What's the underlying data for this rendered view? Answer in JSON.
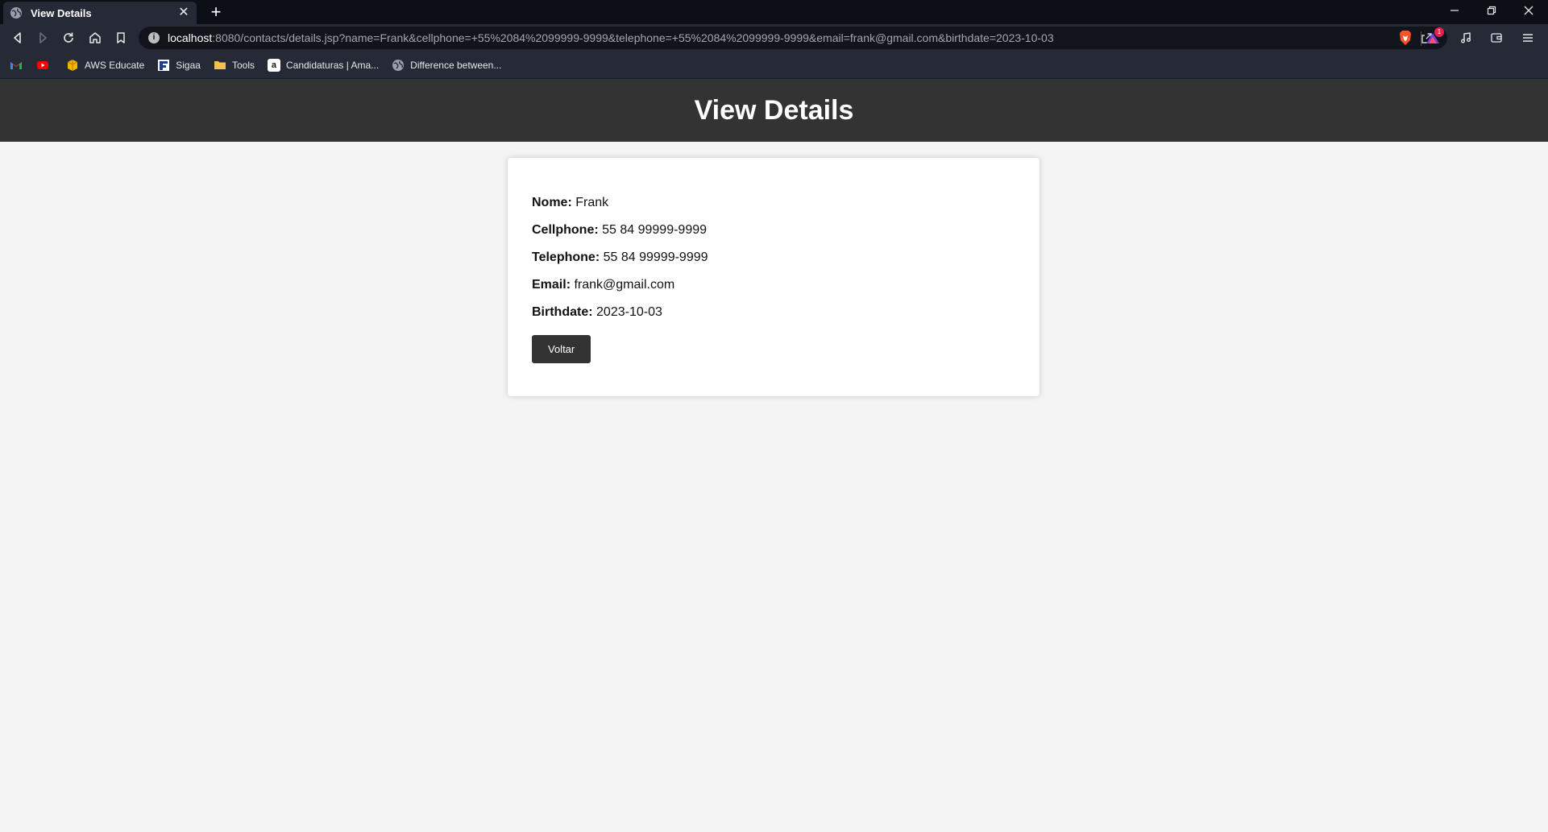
{
  "browser": {
    "tab_title": "View Details",
    "url_host": "localhost",
    "url_rest": ":8080/contacts/details.jsp?name=Frank&cellphone=+55%2084%2099999-9999&telephone=+55%2084%2099999-9999&email=frank@gmail.com&birthdate=2023-10-03",
    "brave_badge": "1",
    "bookmarks": [
      {
        "label": ""
      },
      {
        "label": ""
      },
      {
        "label": "AWS Educate"
      },
      {
        "label": "Sigaa"
      },
      {
        "label": "Tools"
      },
      {
        "label": "Candidaturas | Ama..."
      },
      {
        "label": "Difference between..."
      }
    ]
  },
  "page": {
    "title": "View Details",
    "fields": [
      {
        "label": "Nome:",
        "value": "Frank"
      },
      {
        "label": "Cellphone:",
        "value": "55 84 99999-9999"
      },
      {
        "label": "Telephone:",
        "value": "55 84 99999-9999"
      },
      {
        "label": "Email:",
        "value": "frank@gmail.com"
      },
      {
        "label": "Birthdate:",
        "value": "2023-10-03"
      }
    ],
    "back_button": "Voltar"
  }
}
